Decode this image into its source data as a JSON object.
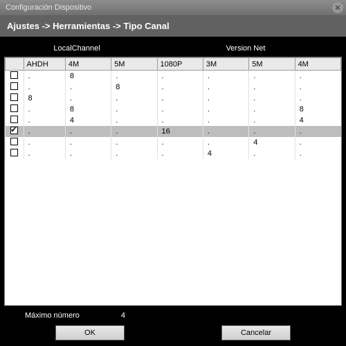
{
  "window": {
    "title": "Configuración Dispositivo"
  },
  "breadcrumb": "Ajustes -> Herramientas -> Tipo Canal",
  "groups": {
    "local": "LocalChannel",
    "net": "Version Net"
  },
  "columns": [
    "AHDH",
    "4M",
    "5M",
    "1080P",
    "3M",
    "5M",
    "4M"
  ],
  "rows": [
    {
      "checked": false,
      "selected": false,
      "cells": [
        ".",
        "8",
        ".",
        ".",
        ".",
        ".",
        "."
      ]
    },
    {
      "checked": false,
      "selected": false,
      "cells": [
        ".",
        ".",
        "8",
        ".",
        ".",
        ".",
        "."
      ]
    },
    {
      "checked": false,
      "selected": false,
      "cells": [
        "8",
        ".",
        ".",
        ".",
        ".",
        ".",
        "."
      ]
    },
    {
      "checked": false,
      "selected": false,
      "cells": [
        ".",
        "8",
        ".",
        ".",
        ".",
        ".",
        "8"
      ]
    },
    {
      "checked": false,
      "selected": false,
      "cells": [
        ".",
        "4",
        ".",
        ".",
        ".",
        ".",
        "4"
      ]
    },
    {
      "checked": true,
      "selected": true,
      "cells": [
        ".",
        ".",
        ".",
        "16",
        ".",
        ".",
        "."
      ]
    },
    {
      "checked": false,
      "selected": false,
      "cells": [
        ".",
        ".",
        ".",
        ".",
        ".",
        "4",
        "."
      ]
    },
    {
      "checked": false,
      "selected": false,
      "cells": [
        ".",
        ".",
        ".",
        ".",
        "4",
        ".",
        "."
      ]
    }
  ],
  "footer": {
    "label": "Máximo número",
    "value": "4"
  },
  "buttons": {
    "ok": "OK",
    "cancel": "Cancelar"
  }
}
